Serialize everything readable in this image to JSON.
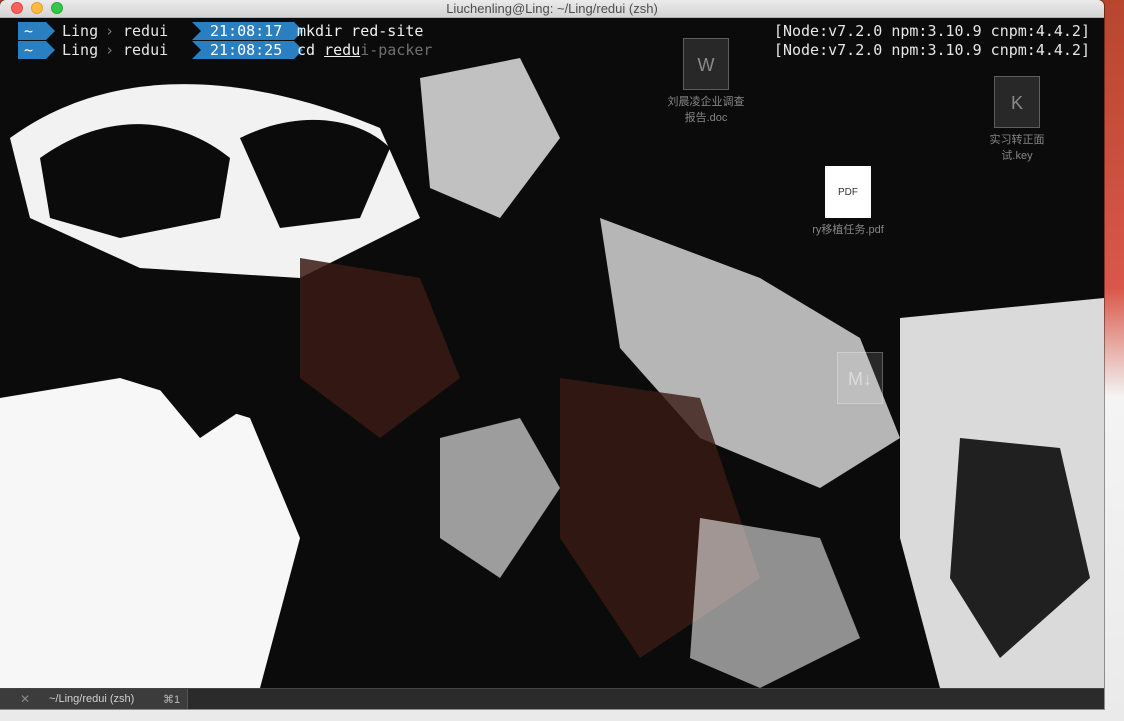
{
  "window": {
    "title": "Liuchenling@Ling: ~/Ling/redui (zsh)"
  },
  "prompt_lines": [
    {
      "home": "~",
      "user": "Ling",
      "dir": "redui",
      "time": "21:08:17",
      "command_typed": "mkdir red-site",
      "command_ghost": "",
      "right": "[Node:v7.2.0 npm:3.10.9 cnpm:4.4.2]"
    },
    {
      "home": "~",
      "user": "Ling",
      "dir": "redui",
      "time": "21:08:25",
      "command_prefix": "cd ",
      "command_typed": "red",
      "command_cursor": "u",
      "command_ghost": "i-packer",
      "right": "[Node:v7.2.0 npm:3.10.9 cnpm:4.4.2]"
    }
  ],
  "tabbar": {
    "tab_title": "~/Ling/redui (zsh)",
    "tab_shortcut": "⌘1",
    "close_glyph": "✕"
  },
  "desktop_icons": [
    {
      "label": "刘晨凌企业调查报告.doc",
      "glyph": "W"
    },
    {
      "label": "实习转正面试.key",
      "glyph": "K"
    },
    {
      "label": "ry移植任务.pdf",
      "glyph": "PDF"
    },
    {
      "label": "M↓",
      "glyph": "M↓"
    }
  ],
  "colors": {
    "segment_blue": "#2a7fc1",
    "terminal_bg": "#0b0b0b",
    "text": "#e6e6e6"
  }
}
